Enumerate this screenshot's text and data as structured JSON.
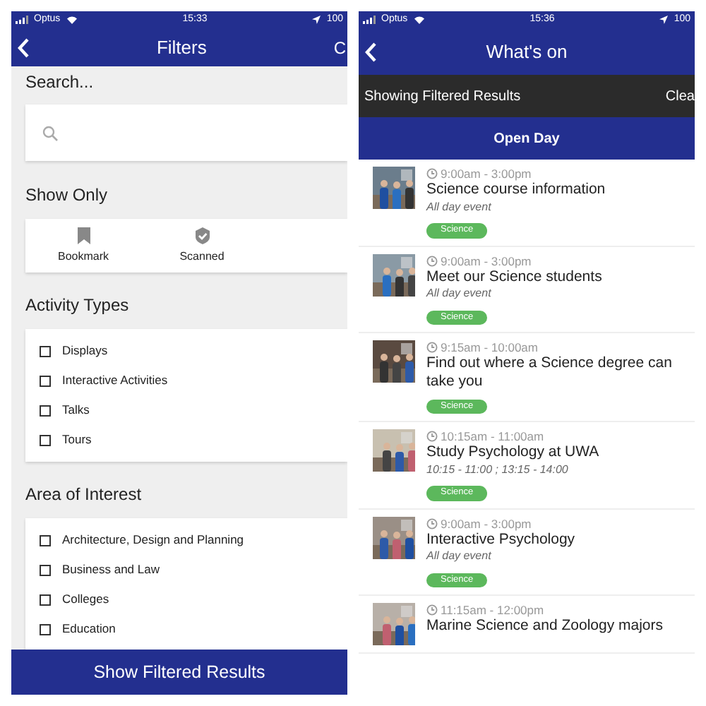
{
  "left": {
    "status": {
      "carrier": "Optus",
      "time": "15:33",
      "battery": "100"
    },
    "nav": {
      "title": "Filters",
      "action": "C"
    },
    "search": {
      "label": "Search..."
    },
    "show_only": {
      "label": "Show Only",
      "options": [
        {
          "label": "Bookmark",
          "kind": "bookmark"
        },
        {
          "label": "Scanned",
          "kind": "scanned"
        }
      ]
    },
    "sections": [
      {
        "title": "Activity Types",
        "items": [
          {
            "label": "Displays",
            "checked": false
          },
          {
            "label": "Interactive Activities",
            "checked": false
          },
          {
            "label": "Talks",
            "checked": false
          },
          {
            "label": "Tours",
            "checked": false
          }
        ]
      },
      {
        "title": "Area of Interest",
        "items": [
          {
            "label": "Architecture, Design and Planning",
            "checked": false
          },
          {
            "label": "Business and Law",
            "checked": false
          },
          {
            "label": "Colleges",
            "checked": false
          },
          {
            "label": "Education",
            "checked": false
          }
        ]
      }
    ],
    "apply_button": "Show Filtered Results"
  },
  "right": {
    "status": {
      "carrier": "Optus",
      "time": "15:36",
      "battery": "100"
    },
    "nav": {
      "title": "What's on"
    },
    "filter_bar": {
      "text": "Showing Filtered Results",
      "action": "Clea"
    },
    "event_title": "Open Day",
    "events": [
      {
        "time": "9:00am - 3:00pm",
        "title": "Science course information",
        "note": "All day event",
        "tag": "Science"
      },
      {
        "time": "9:00am - 3:00pm",
        "title": "Meet our Science students",
        "note": "All day event",
        "tag": "Science"
      },
      {
        "time": "9:15am - 10:00am",
        "title": "Find out where a Science degree can take you",
        "tag": "Science"
      },
      {
        "time": "10:15am - 11:00am",
        "title": "Study Psychology at UWA",
        "note": "10:15 - 11:00 ; 13:15 - 14:00",
        "tag": "Science"
      },
      {
        "time": "9:00am - 3:00pm",
        "title": "Interactive Psychology",
        "note": "All day event",
        "tag": "Science"
      },
      {
        "time": "11:15am - 12:00pm",
        "title": "Marine Science and Zoology majors"
      }
    ]
  }
}
